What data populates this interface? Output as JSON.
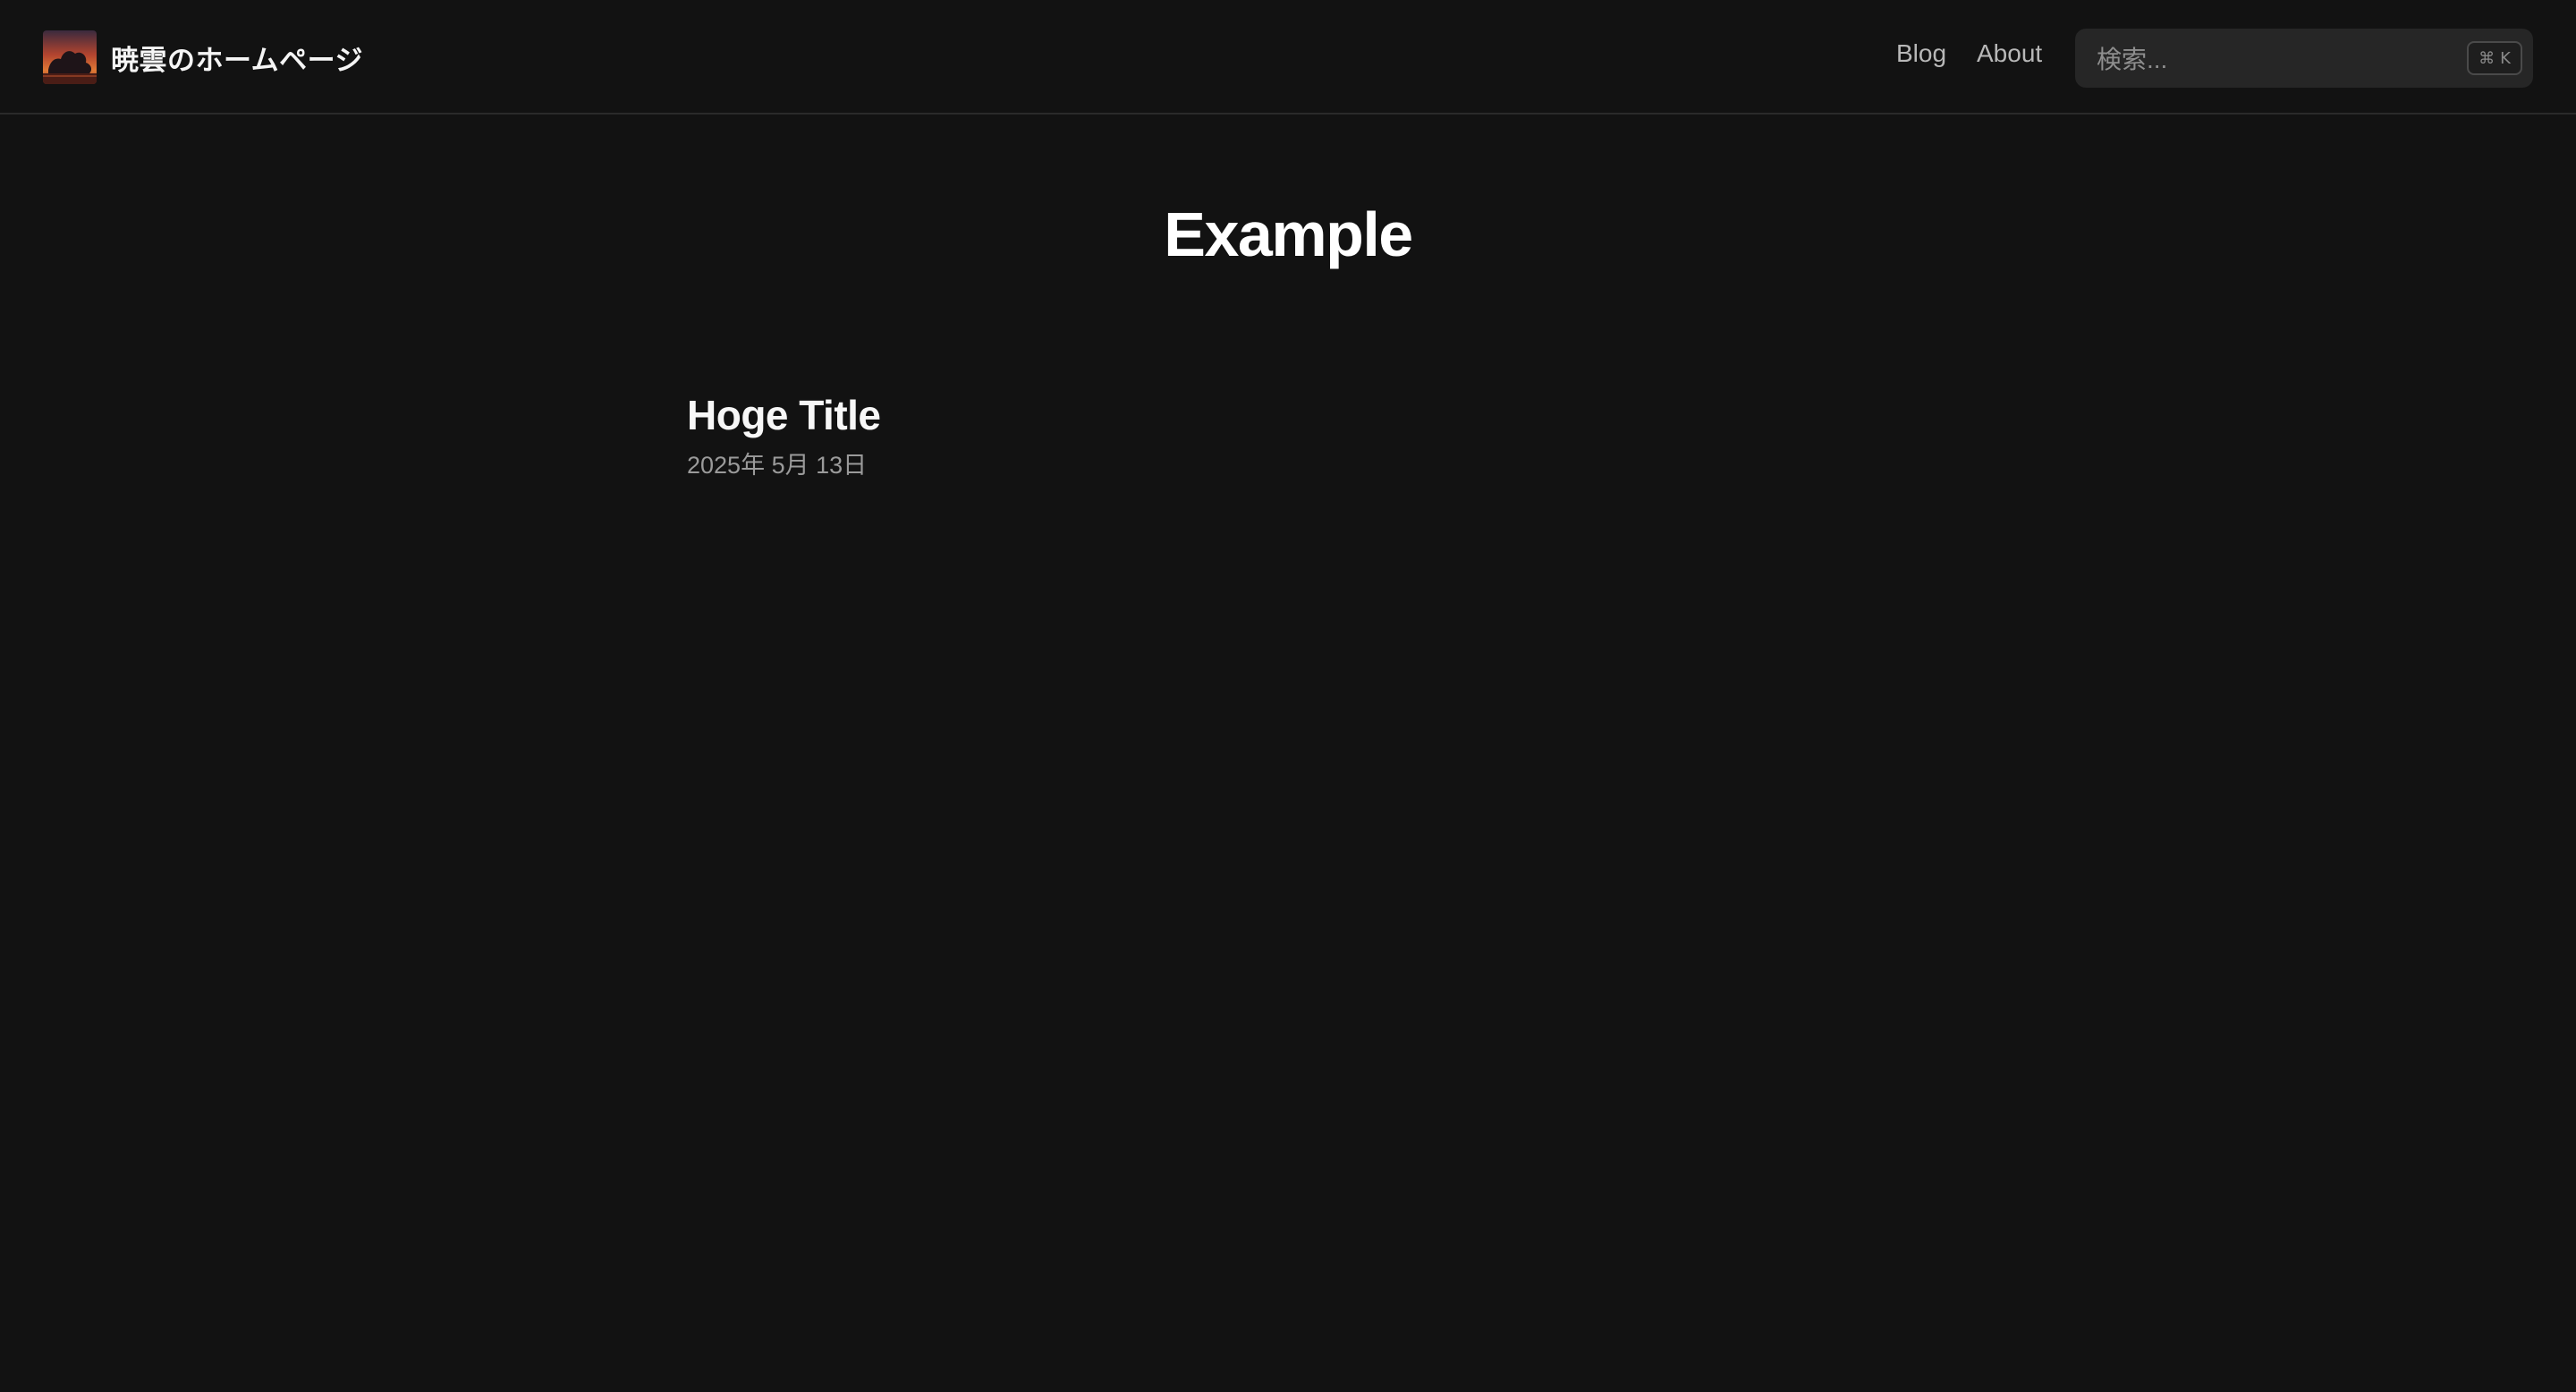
{
  "header": {
    "site_title": "暁雲のホームページ",
    "logo_icon": "sunset-cloud-logo",
    "nav": [
      {
        "label": "Blog"
      },
      {
        "label": "About"
      }
    ],
    "search": {
      "placeholder": "検索...",
      "shortcut_symbol": "⌘",
      "shortcut_key": "K"
    }
  },
  "main": {
    "page_title": "Example",
    "posts": [
      {
        "title": "Hoge Title",
        "date": "2025年 5月 13日"
      }
    ]
  },
  "colors": {
    "background": "#121212",
    "text_primary": "#ffffff",
    "text_muted": "#9a9a9a",
    "search_bg": "#262626",
    "border": "#2a2a2a"
  }
}
